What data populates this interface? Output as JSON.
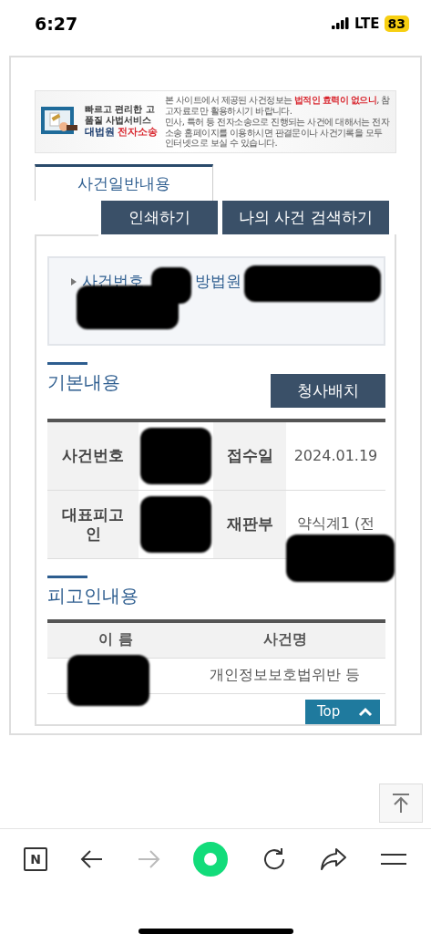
{
  "status_bar": {
    "time": "6:27",
    "network": "LTE",
    "battery": "83"
  },
  "banner": {
    "tagline": "빠르고 편리한 고품질 사법서비스",
    "brand_name": "대법원",
    "brand_service": "전자소송",
    "notices": [
      "본 사이트에서 제공된 사건정보는 **법적인 효력이 없으니**, 참고자료로만 활용하시기 바랍니다.",
      "민사, 특허 등 전자소송으로 진행되는 사건에 대해서는 전자소송 홈페이지를 이용하시면 판결문이나 사건기록을 모두 인터넷으로 보실 수 있습니다."
    ]
  },
  "tabs": [
    {
      "label": "사건일반내용",
      "selected": true
    }
  ],
  "actions": [
    "인쇄하기",
    "나의 사건 검색하기"
  ],
  "case_header": {
    "label_start": "사건번호",
    "label_end": "방법원",
    "redacted": true
  },
  "basic_info": {
    "title": "기본내용",
    "button": "청사배치",
    "rows": [
      {
        "fields": [
          {
            "label": "사건번호",
            "redacted": true
          },
          {
            "label": "접수일",
            "value": "2024.01.19",
            "redacted": false
          }
        ]
      },
      {
        "fields": [
          {
            "label": "대표피고인",
            "redacted": true
          },
          {
            "label": "재판부",
            "value": "약식계1 (전",
            "redacted": true
          }
        ]
      }
    ]
  },
  "defendants": {
    "title": "피고인내용",
    "columns": [
      "이 름",
      "사건명"
    ],
    "rows": [
      {
        "name_redacted": true,
        "case_name": "개인정보보호법위반 등"
      }
    ]
  },
  "top_button": "Top",
  "browser_toolbar": {
    "logo": "N",
    "forward_disabled": true
  }
}
